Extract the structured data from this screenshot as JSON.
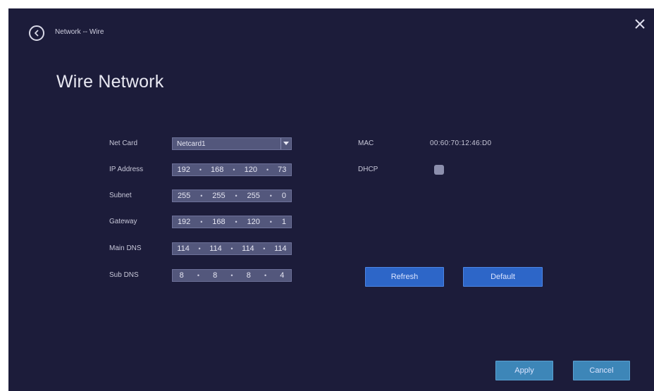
{
  "header": {
    "breadcrumb": "Network -- Wire",
    "back_icon": "back-circle-icon",
    "close_icon": "close-icon"
  },
  "page": {
    "title": "Wire Network"
  },
  "form": {
    "net_card": {
      "label": "Net Card",
      "value": "Netcard1"
    },
    "ip_address": {
      "label": "IP Address",
      "octets": [
        "192",
        "168",
        "120",
        "73"
      ]
    },
    "subnet": {
      "label": "Subnet",
      "octets": [
        "255",
        "255",
        "255",
        "0"
      ]
    },
    "gateway": {
      "label": "Gateway",
      "octets": [
        "192",
        "168",
        "120",
        "1"
      ]
    },
    "main_dns": {
      "label": "Main DNS",
      "octets": [
        "114",
        "114",
        "114",
        "114"
      ]
    },
    "sub_dns": {
      "label": "Sub DNS",
      "octets": [
        "8",
        "8",
        "8",
        "4"
      ]
    },
    "mac": {
      "label": "MAC",
      "value": "00:60:70:12:46:D0"
    },
    "dhcp": {
      "label": "DHCP",
      "checked": false
    }
  },
  "buttons": {
    "refresh": "Refresh",
    "default": "Default",
    "apply": "Apply",
    "cancel": "Cancel"
  },
  "colors": {
    "panel_bg": "#1c1c3a",
    "field_bg": "#53577c",
    "button_blue": "#2d66c8",
    "button_teal": "#3d86b8"
  }
}
